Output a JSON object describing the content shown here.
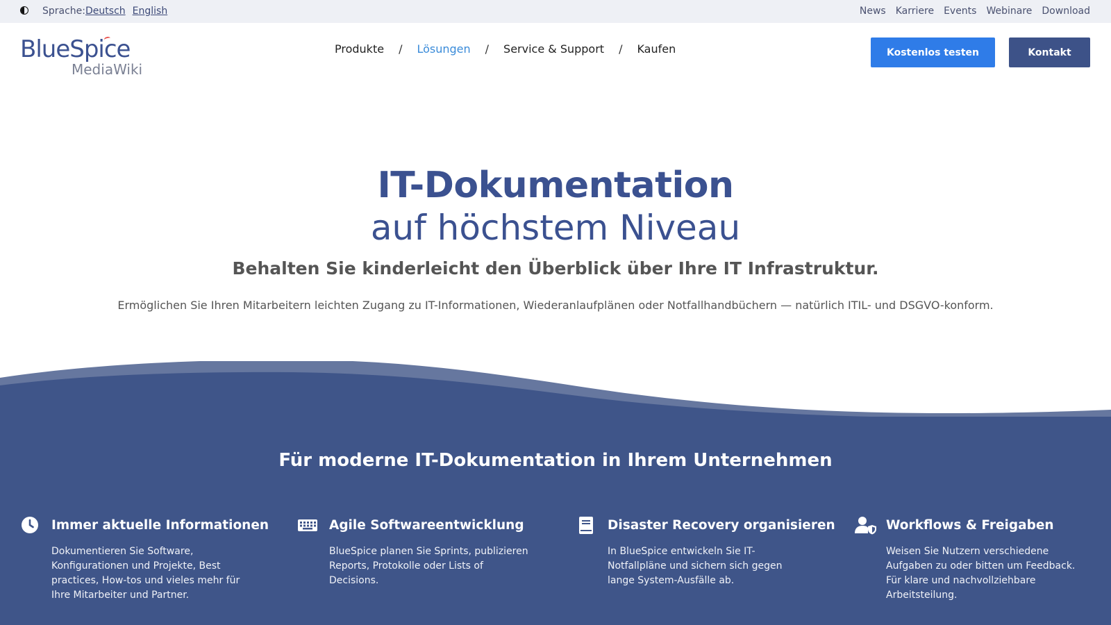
{
  "topbar": {
    "language_label": "Sprache:",
    "languages": [
      "Deutsch",
      "English"
    ],
    "links": [
      "News",
      "Karriere",
      "Events",
      "Webinare",
      "Download"
    ]
  },
  "logo": {
    "line1": "BlueSpice",
    "line2": "MediaWiki"
  },
  "nav": {
    "items": [
      "Produkte",
      "Lösungen",
      "Service & Support",
      "Kaufen"
    ],
    "separator": "/",
    "active": "Lösungen"
  },
  "buttons": {
    "try": "Kostenlos testen",
    "contact": "Kontakt"
  },
  "hero": {
    "title": "IT-Dokumentation",
    "subtitle": "auf höchstem Niveau",
    "tagline": "Behalten Sie kinderleicht den Überblick über Ihre IT Infrastruktur.",
    "description": "Ermöglichen Sie Ihren Mitarbeitern leichten Zugang zu IT-Informationen, Wiederanlaufplänen oder Notfallhandbüchern — natürlich ITIL- und DSGVO-konform."
  },
  "features_section": {
    "title": "Für moderne IT-Dokumentation in Ihrem Unternehmen",
    "items": [
      {
        "icon": "clock-icon",
        "title": "Immer aktuelle Informationen",
        "text": "Dokumentieren Sie Software, Konfigurationen und Projekte, Best practices, How-tos und vieles mehr für Ihre Mitarbeiter und Partner."
      },
      {
        "icon": "keyboard-icon",
        "title": "Agile Softwareentwicklung",
        "text": "BlueSpice planen Sie Sprints, publizieren Reports, Protokolle oder Lists of Decisions."
      },
      {
        "icon": "book-icon",
        "title": "Disaster Recovery organisieren",
        "text": "In BlueSpice entwickeln Sie IT-Notfallpläne und sichern sich gegen lange System-Ausfälle ab."
      },
      {
        "icon": "user-shield-icon",
        "title": "Workflows & Freigaben",
        "text": "Weisen Sie Nutzern verschiedene Aufgaben zu oder bitten um Feedback. Für klare und nachvollziehbare Arbeitsteilung."
      }
    ]
  },
  "colors": {
    "brand_blue": "#3b5190",
    "section_blue": "#3f5589",
    "button_blue": "#2f7ce8",
    "active_link": "#3a8bd9",
    "logo_accent": "#e8504c"
  }
}
